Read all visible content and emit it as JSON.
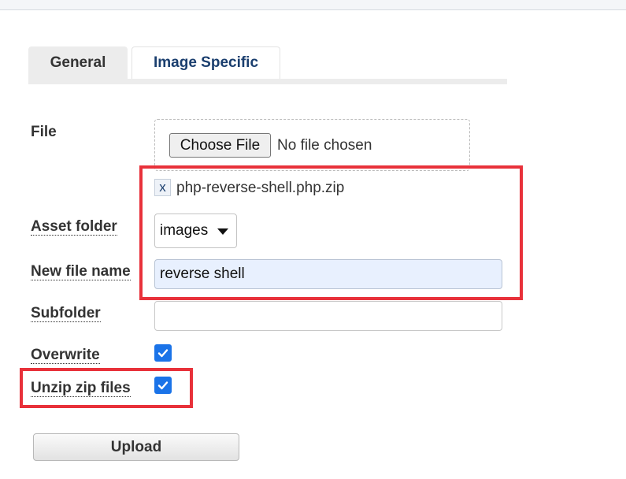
{
  "tabs": [
    {
      "label": "General",
      "active": true
    },
    {
      "label": "Image Specific",
      "active": false
    }
  ],
  "fields": {
    "file": {
      "label": "File",
      "choose_button": "Choose File",
      "status": "No file chosen",
      "remove_label": "x",
      "selected_file": "php-reverse-shell.php.zip"
    },
    "asset_folder": {
      "label": "Asset folder",
      "selected": "images"
    },
    "new_file_name": {
      "label": "New file name",
      "value": "reverse shell",
      "placeholder": ""
    },
    "subfolder": {
      "label": "Subfolder",
      "value": "",
      "placeholder": ""
    },
    "overwrite": {
      "label": "Overwrite",
      "checked": true
    },
    "unzip": {
      "label": "Unzip zip files",
      "checked": true
    }
  },
  "upload_button": "Upload",
  "colors": {
    "annotation": "#e8313a",
    "checkbox": "#1a73e8",
    "tab_active_text": "#1a3e6e",
    "autofill_bg": "#e8f0fe"
  },
  "icons": {
    "checkbox": "check-icon",
    "dropdown": "caret-down-icon"
  }
}
